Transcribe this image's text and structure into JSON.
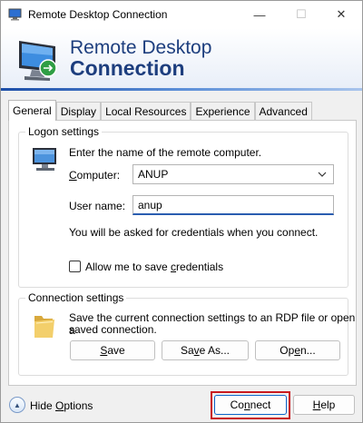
{
  "window": {
    "title": "Remote Desktop Connection",
    "controls": {
      "minimize": "—",
      "maximize": "☐",
      "close": "✕"
    }
  },
  "banner": {
    "line1": "Remote Desktop",
    "line2": "Connection",
    "icon": "remote-desktop-monitor-icon"
  },
  "tabs": [
    {
      "label": "General",
      "active": true
    },
    {
      "label": "Display",
      "active": false
    },
    {
      "label": "Local Resources",
      "active": false
    },
    {
      "label": "Experience",
      "active": false
    },
    {
      "label": "Advanced",
      "active": false
    }
  ],
  "logon": {
    "group_label": "Logon settings",
    "instruction": "Enter the name of the remote computer.",
    "computer_label": "Computer:",
    "computer_value": "ANUP",
    "username_label": "User name:",
    "username_value": "anup",
    "credentials_note": "You will be asked for credentials when you connect.",
    "save_credentials_label": "Allow me to save credentials",
    "save_credentials_checked": false
  },
  "connection": {
    "group_label": "Connection settings",
    "description_line1": "Save the current connection settings to an RDP file or open a",
    "description_line2": "saved connection.",
    "save_label": "Save",
    "save_as_label": "Save As...",
    "open_label": "Open..."
  },
  "footer": {
    "hide_options_label": "Hide Options",
    "connect_label": "Connect",
    "help_label": "Help"
  },
  "colors": {
    "banner_text": "#1d3e7e",
    "highlight": "#c8191f",
    "input_focus": "#2a5db0"
  }
}
